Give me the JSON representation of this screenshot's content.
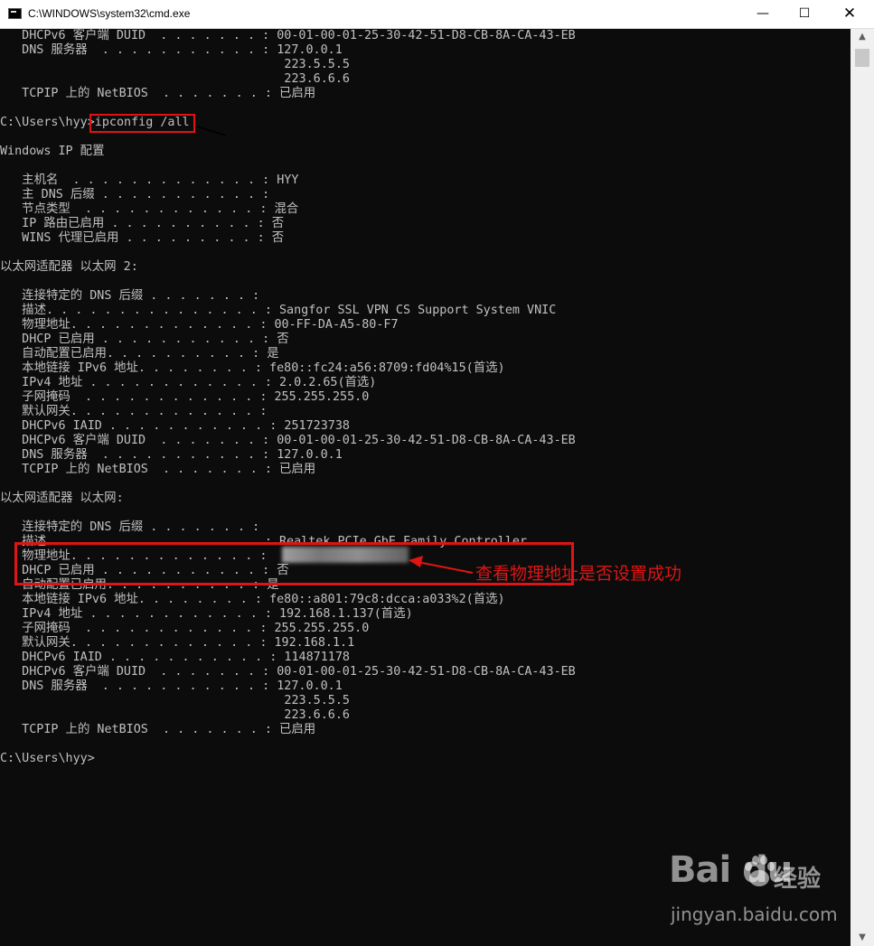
{
  "window": {
    "title": "C:\\WINDOWS\\system32\\cmd.exe",
    "minimize_glyph": "—",
    "maximize_glyph": "☐",
    "close_glyph": "✕"
  },
  "console_lines": [
    "   DHCPv6 客户端 DUID  . . . . . . . : 00-01-00-01-25-30-42-51-D8-CB-8A-CA-43-EB",
    "   DNS 服务器  . . . . . . . . . . . : 127.0.0.1",
    "                                       223.5.5.5",
    "                                       223.6.6.6",
    "   TCPIP 上的 NetBIOS  . . . . . . . : 已启用",
    "",
    "C:\\Users\\hyy>ipconfig /all",
    "",
    "Windows IP 配置",
    "",
    "   主机名  . . . . . . . . . . . . . : HYY",
    "   主 DNS 后缀 . . . . . . . . . . . :",
    "   节点类型  . . . . . . . . . . . . : 混合",
    "   IP 路由已启用 . . . . . . . . . . : 否",
    "   WINS 代理已启用 . . . . . . . . . : 否",
    "",
    "以太网适配器 以太网 2:",
    "",
    "   连接特定的 DNS 后缀 . . . . . . . :",
    "   描述. . . . . . . . . . . . . . . : Sangfor SSL VPN CS Support System VNIC",
    "   物理地址. . . . . . . . . . . . . : 00-FF-DA-A5-80-F7",
    "   DHCP 已启用 . . . . . . . . . . . : 否",
    "   自动配置已启用. . . . . . . . . . : 是",
    "   本地链接 IPv6 地址. . . . . . . . : fe80::fc24:a56:8709:fd04%15(首选)",
    "   IPv4 地址 . . . . . . . . . . . . : 2.0.2.65(首选)",
    "   子网掩码  . . . . . . . . . . . . : 255.255.255.0",
    "   默认网关. . . . . . . . . . . . . :",
    "   DHCPv6 IAID . . . . . . . . . . . : 251723738",
    "   DHCPv6 客户端 DUID  . . . . . . . : 00-01-00-01-25-30-42-51-D8-CB-8A-CA-43-EB",
    "   DNS 服务器  . . . . . . . . . . . : 127.0.0.1",
    "   TCPIP 上的 NetBIOS  . . . . . . . : 已启用",
    "",
    "以太网适配器 以太网:",
    "",
    "   连接特定的 DNS 后缀 . . . . . . . :",
    "   描述. . . . . . . . . . . . . . . : Realtek PCIe GbE Family Controller",
    "   物理地址. . . . . . . . . . . . . :",
    "   DHCP 已启用 . . . . . . . . . . . : 否",
    "   自动配置已启用. . . . . . . . . . : 是",
    "   本地链接 IPv6 地址. . . . . . . . : fe80::a801:79c8:dcca:a033%2(首选)",
    "   IPv4 地址 . . . . . . . . . . . . : 192.168.1.137(首选)",
    "   子网掩码  . . . . . . . . . . . . : 255.255.255.0",
    "   默认网关. . . . . . . . . . . . . : 192.168.1.1",
    "   DHCPv6 IAID . . . . . . . . . . . : 114871178",
    "   DHCPv6 客户端 DUID  . . . . . . . : 00-01-00-01-25-30-42-51-D8-CB-8A-CA-43-EB",
    "   DNS 服务器  . . . . . . . . . . . : 127.0.0.1",
    "                                       223.5.5.5",
    "                                       223.6.6.6",
    "   TCPIP 上的 NetBIOS  . . . . . . . : 已启用",
    "",
    "C:\\Users\\hyy>"
  ],
  "annotation": {
    "text": "查看物理地址是否设置成功",
    "color": "#e01414"
  },
  "colors": {
    "console_background": "#0c0c0c",
    "console_text": "#c0c0c0",
    "highlight": "#e01414"
  },
  "watermark": {
    "logo": "Bai  du",
    "brand_cn": "经验",
    "url": "jingyan.baidu.com"
  },
  "scrollbar": {
    "up_glyph": "▲",
    "down_glyph": "▼"
  }
}
